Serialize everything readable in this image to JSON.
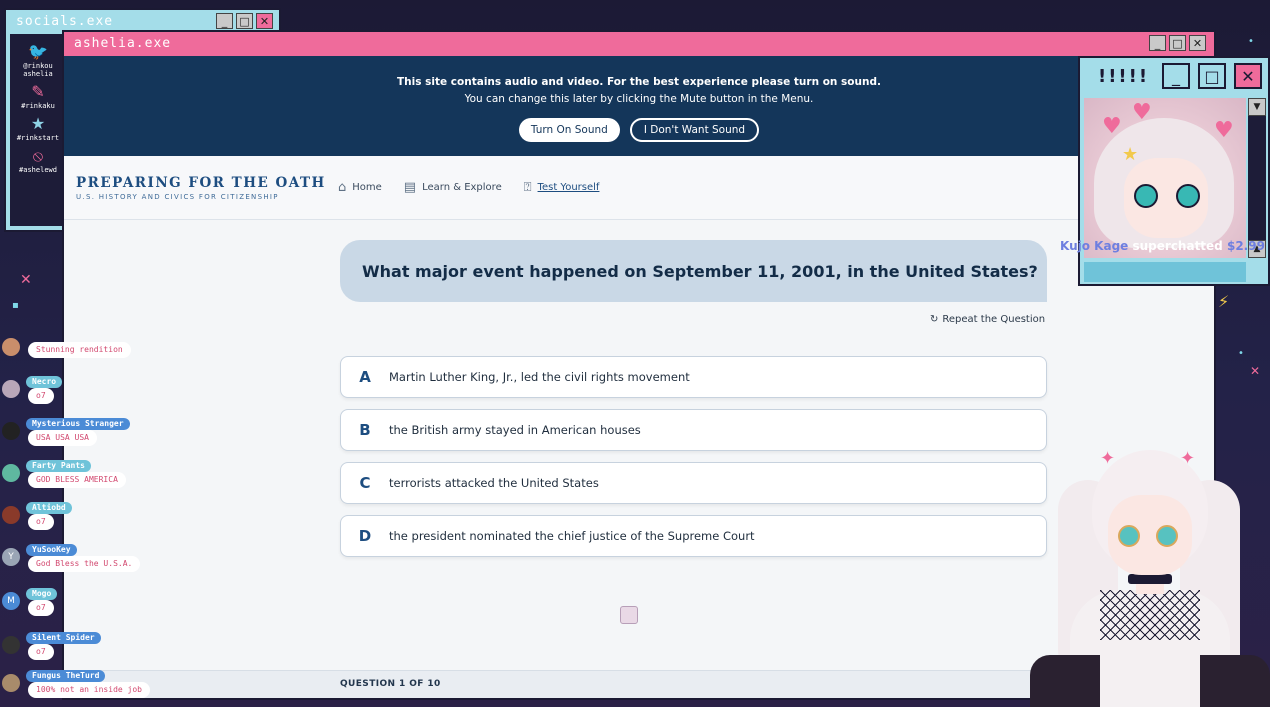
{
  "socials_window": {
    "title": "socials.exe",
    "items": [
      {
        "icon": "twitter-bird-icon",
        "label": "@rinkou\nashelia"
      },
      {
        "icon": "paintbrush-icon",
        "label": "#rinkaku"
      },
      {
        "icon": "star-icon",
        "label": "#rinkstart"
      },
      {
        "icon": "ban-icon",
        "label": "#ashelewd"
      }
    ]
  },
  "main_window": {
    "title": "ashelia.exe"
  },
  "sound_notice": {
    "line1": "This site contains audio and video. For the best experience please turn on sound.",
    "line2": "You can change this later by clicking the Mute button in the Menu.",
    "turn_on_label": "Turn On Sound",
    "decline_label": "I Don't Want Sound"
  },
  "site": {
    "logo_main": "PREPARING FOR THE OATH",
    "logo_sub": "U.S. HISTORY AND CIVICS FOR CITIZENSHIP",
    "nav": [
      {
        "label": "Home",
        "icon": "home-icon"
      },
      {
        "label": "Learn & Explore",
        "icon": "book-icon"
      },
      {
        "label": "Test Yourself",
        "icon": "question-icon"
      }
    ]
  },
  "quiz": {
    "question": "What major event happened on September 11, 2001, in the United States?",
    "repeat_label": "Repeat the Question",
    "answers": [
      {
        "letter": "A",
        "text": "Martin Luther King, Jr., led the civil rights movement"
      },
      {
        "letter": "B",
        "text": "the British army stayed in American houses"
      },
      {
        "letter": "C",
        "text": "terrorists attacked the United States"
      },
      {
        "letter": "D",
        "text": "the president nominated the chief justice of the Supreme Court"
      }
    ],
    "progress": "QUESTION 1 OF 10"
  },
  "avatar_window": {
    "title": "!!!!!"
  },
  "superchat": {
    "user": "Kujo Kage",
    "text": "superchatted",
    "amount": "$2.99"
  },
  "chat": [
    {
      "name": "",
      "text": "Stunning rendition",
      "color": "#c98e6b"
    },
    {
      "name": "Necro",
      "text": "o7",
      "color": "#b9a7b8"
    },
    {
      "name": "Mysterious Stranger",
      "text": "USA USA USA",
      "color": "#222"
    },
    {
      "name": "Farty Pants",
      "text": "GOD BLESS AMERICA",
      "color": "#5fb8a0"
    },
    {
      "name": "Altiobd",
      "text": "o7",
      "color": "#8a3a2a"
    },
    {
      "name": "YuSooKey",
      "text": "God Bless the U.S.A.",
      "color": "#9aa5b5",
      "initial": "Y"
    },
    {
      "name": "Mogo",
      "text": "o7",
      "color": "#4b8bd6",
      "initial": "M"
    },
    {
      "name": "Silent Spider",
      "text": "o7",
      "color": "#333"
    },
    {
      "name": "Fungus TheTurd",
      "text": "100% not an inside job",
      "color": "#a88b6b"
    }
  ]
}
